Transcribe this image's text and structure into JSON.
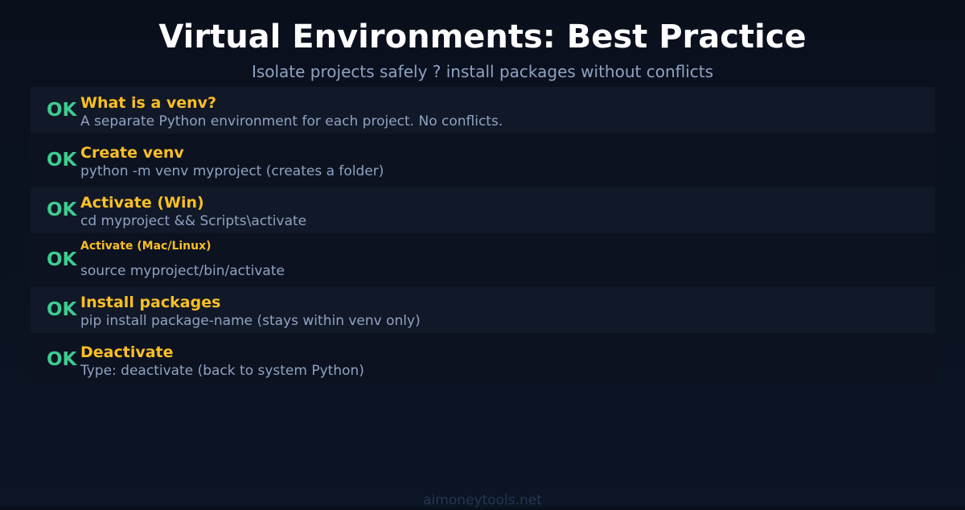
{
  "header": {
    "title": "Virtual Environments: Best Practice",
    "subtitle": "Isolate projects safely ? install packages without conflicts"
  },
  "items": [
    {
      "status": "OK",
      "title": "What is a venv?",
      "description": "A separate Python environment for each project. No conflicts."
    },
    {
      "status": "OK",
      "title": "Create venv",
      "description": "python -m venv myproject (creates a folder)"
    },
    {
      "status": "OK",
      "title": "Activate (Win)",
      "description": "cd myproject && Scripts\\activate"
    },
    {
      "status": "OK",
      "title": "Activate (Mac/Linux)",
      "description": "source myproject/bin/activate"
    },
    {
      "status": "OK",
      "title": "Install packages",
      "description": "pip install package-name (stays within venv only)"
    },
    {
      "status": "OK",
      "title": "Deactivate",
      "description": "Type: deactivate (back to system Python)"
    }
  ],
  "footer": {
    "site": "aimoneytools.net"
  },
  "colors": {
    "background": "#0a0f1c",
    "title": "#ffffff",
    "subtitle": "#8fa3c2",
    "accent_ok": "#3dcc91",
    "item_title": "#fbbf24"
  }
}
